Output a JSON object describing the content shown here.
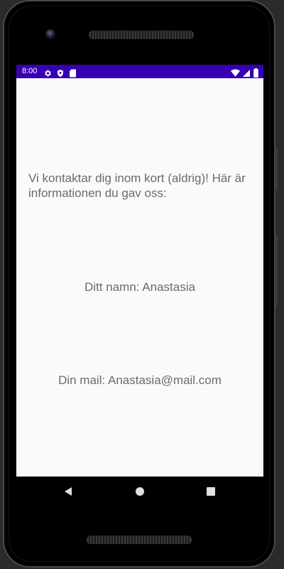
{
  "status_bar": {
    "time": "8:00",
    "background_color": "#3700b3",
    "left_icons": [
      "settings-icon",
      "shield-icon",
      "sd-card-icon"
    ],
    "right_icons": [
      "wifi-icon",
      "signal-icon",
      "battery-icon"
    ]
  },
  "main": {
    "intro_text": "Vi kontaktar dig inom kort (aldrig)! Här är informationen du gav oss:",
    "name_text": "Ditt namn: Anastasia",
    "mail_text": "Din mail: Anastasia@mail.com",
    "text_color": "#6b6b6b",
    "background_color": "#fafafa"
  },
  "navigation_bar": {
    "buttons": [
      "back-icon",
      "home-icon",
      "recents-icon"
    ]
  }
}
